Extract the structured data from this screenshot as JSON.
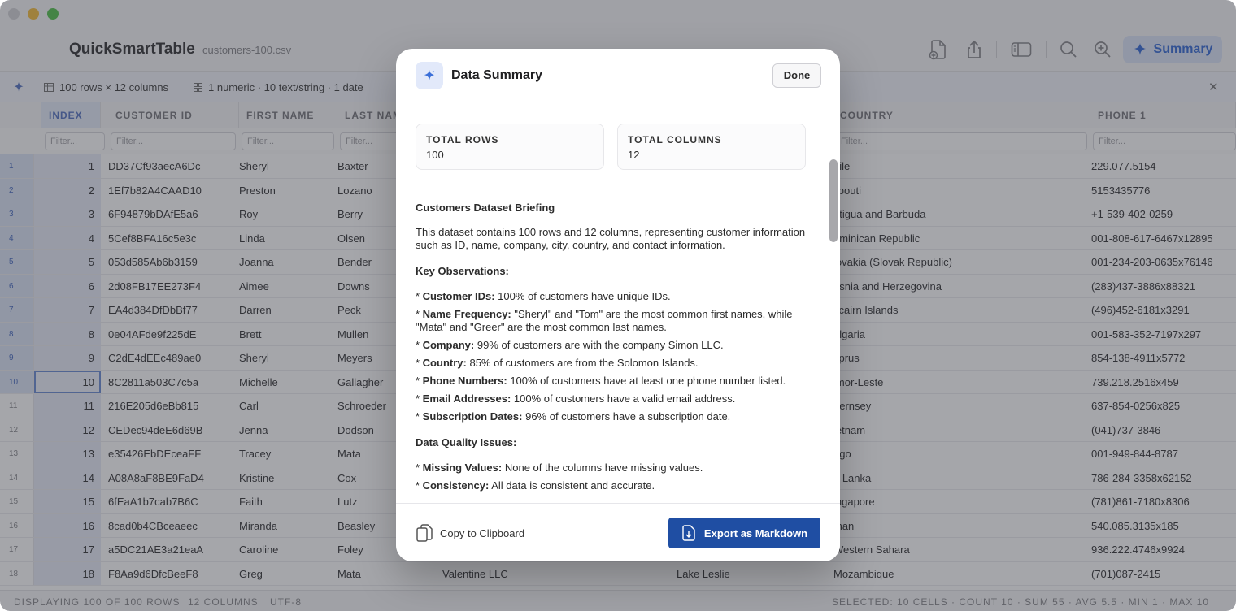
{
  "app": {
    "title": "QuickSmartTable",
    "file_name": "customers-100.csv",
    "summary_label": "Summary"
  },
  "infobar": {
    "rows_cols": "100 rows × 12 columns",
    "types": "1 numeric · 10 text/string · 1 date"
  },
  "table": {
    "headers": [
      "INDEX",
      "CUSTOMER ID",
      "FIRST NAME",
      "LAST NAM",
      "COUNTRY",
      "PHONE 1"
    ],
    "filter_placeholder": "Filter...",
    "rows": [
      {
        "n": "1",
        "idx": "1",
        "cid": "DD37Cf93aecA6Dc",
        "first": "Sheryl",
        "last": "Baxter",
        "company": "",
        "city": "",
        "country": "hile",
        "phone": "229.077.5154"
      },
      {
        "n": "2",
        "idx": "2",
        "cid": "1Ef7b82A4CAAD10",
        "first": "Preston",
        "last": "Lozano",
        "company": "",
        "city": "",
        "country": "jibouti",
        "phone": "5153435776"
      },
      {
        "n": "3",
        "idx": "3",
        "cid": "6F94879bDAfE5a6",
        "first": "Roy",
        "last": "Berry",
        "company": "",
        "city": "",
        "country": "ntigua and Barbuda",
        "phone": "+1-539-402-0259"
      },
      {
        "n": "4",
        "idx": "4",
        "cid": "5Cef8BFA16c5e3c",
        "first": "Linda",
        "last": "Olsen",
        "company": "",
        "city": "",
        "country": "ominican Republic",
        "phone": "001-808-617-6467x12895"
      },
      {
        "n": "5",
        "idx": "5",
        "cid": "053d585Ab6b3159",
        "first": "Joanna",
        "last": "Bender",
        "company": "",
        "city": "",
        "country": "lovakia (Slovak Republic)",
        "phone": "001-234-203-0635x76146"
      },
      {
        "n": "6",
        "idx": "6",
        "cid": "2d08FB17EE273F4",
        "first": "Aimee",
        "last": "Downs",
        "company": "",
        "city": "",
        "country": "osnia and Herzegovina",
        "phone": "(283)437-3886x88321"
      },
      {
        "n": "7",
        "idx": "7",
        "cid": "EA4d384DfDbBf77",
        "first": "Darren",
        "last": "Peck",
        "company": "",
        "city": "",
        "country": "itcairn Islands",
        "phone": "(496)452-6181x3291"
      },
      {
        "n": "8",
        "idx": "8",
        "cid": "0e04AFde9f225dE",
        "first": "Brett",
        "last": "Mullen",
        "company": "",
        "city": "",
        "country": "ulgaria",
        "phone": "001-583-352-7197x297"
      },
      {
        "n": "9",
        "idx": "9",
        "cid": "C2dE4dEEc489ae0",
        "first": "Sheryl",
        "last": "Meyers",
        "company": "",
        "city": "",
        "country": "yprus",
        "phone": "854-138-4911x5772"
      },
      {
        "n": "10",
        "idx": "10",
        "cid": "8C2811a503C7c5a",
        "first": "Michelle",
        "last": "Gallagher",
        "company": "",
        "city": "",
        "country": "imor-Leste",
        "phone": "739.218.2516x459"
      },
      {
        "n": "11",
        "idx": "11",
        "cid": "216E205d6eBb815",
        "first": "Carl",
        "last": "Schroeder",
        "company": "",
        "city": "",
        "country": "uernsey",
        "phone": "637-854-0256x825"
      },
      {
        "n": "12",
        "idx": "12",
        "cid": "CEDec94deE6d69B",
        "first": "Jenna",
        "last": "Dodson",
        "company": "",
        "city": "",
        "country": "ietnam",
        "phone": "(041)737-3846"
      },
      {
        "n": "13",
        "idx": "13",
        "cid": "e35426EbDEceaFF",
        "first": "Tracey",
        "last": "Mata",
        "company": "",
        "city": "",
        "country": "ogo",
        "phone": "001-949-844-8787"
      },
      {
        "n": "14",
        "idx": "14",
        "cid": "A08A8aF8BE9FaD4",
        "first": "Kristine",
        "last": "Cox",
        "company": "",
        "city": "",
        "country": "ri Lanka",
        "phone": "786-284-3358x62152"
      },
      {
        "n": "15",
        "idx": "15",
        "cid": "6fEaA1b7cab7B6C",
        "first": "Faith",
        "last": "Lutz",
        "company": "",
        "city": "",
        "country": "ingapore",
        "phone": "(781)861-7180x8306"
      },
      {
        "n": "16",
        "idx": "16",
        "cid": "8cad0b4CBceaeec",
        "first": "Miranda",
        "last": "Beasley",
        "company": "",
        "city": "",
        "country": "man",
        "phone": "540.085.3135x185"
      },
      {
        "n": "17",
        "idx": "17",
        "cid": "a5DC21AE3a21eaA",
        "first": "Caroline",
        "last": "Foley",
        "company": "",
        "city": "",
        "country": "Western Sahara",
        "phone": "936.222.4746x9924"
      },
      {
        "n": "18",
        "idx": "18",
        "cid": "F8Aa9d6DfcBeeF8",
        "first": "Greg",
        "last": "Mata",
        "company": "Valentine LLC",
        "city": "Lake Leslie",
        "country": "Mozambique",
        "phone": "(701)087-2415"
      }
    ]
  },
  "status": {
    "left1": "DISPLAYING 100 OF 100 ROWS",
    "left2": "12 COLUMNS",
    "left3": "UTF-8",
    "right": "SELECTED: 10 CELLS · COUNT 10 · SUM 55 · AVG 5.5 · MIN 1 · MAX 10"
  },
  "modal": {
    "title": "Data Summary",
    "done_label": "Done",
    "total_rows_label": "TOTAL ROWS",
    "total_rows_value": "100",
    "total_cols_label": "TOTAL COLUMNS",
    "total_cols_value": "12",
    "briefing_heading": "Customers Dataset Briefing",
    "briefing_text": "This dataset contains 100 rows and 12 columns, representing customer information such as ID, name, company, city, country, and contact information.",
    "observations_heading": "Key Observations:",
    "observations": [
      {
        "key": "Customer IDs:",
        "text": "100% of customers have unique IDs."
      },
      {
        "key": "Name Frequency:",
        "text": "\"Sheryl\" and \"Tom\" are the most common first names, while \"Mata\" and \"Greer\" are the most common last names."
      },
      {
        "key": "Company:",
        "text": "99% of customers are with the company Simon LLC."
      },
      {
        "key": "Country:",
        "text": "85% of customers are from the Solomon Islands."
      },
      {
        "key": "Phone Numbers:",
        "text": "100% of customers have at least one phone number listed."
      },
      {
        "key": "Email Addresses:",
        "text": "100% of customers have a valid email address."
      },
      {
        "key": "Subscription Dates:",
        "text": "96% of customers have a subscription date."
      }
    ],
    "quality_heading": "Data Quality Issues:",
    "quality": [
      {
        "key": "Missing Values:",
        "text": "None of the columns have missing values."
      },
      {
        "key": "Consistency:",
        "text": "All data is consistent and accurate."
      }
    ],
    "copy_label": "Copy to Clipboard",
    "export_label": "Export as Markdown"
  },
  "colors": {
    "accent": "#3b6fd8",
    "export_button": "#1f4ea3",
    "close": "#d5d5d8",
    "minimize": "#f5c044",
    "maximize": "#5bc453"
  }
}
